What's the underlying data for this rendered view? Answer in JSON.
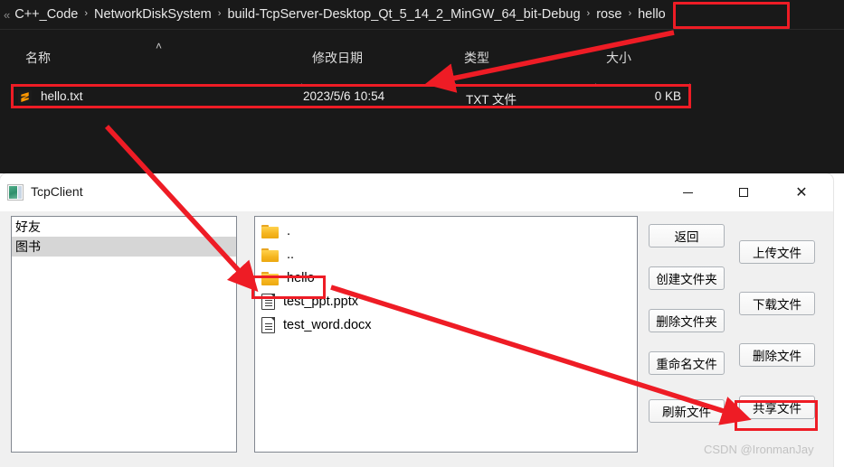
{
  "explorer": {
    "breadcrumb": {
      "overflow_glyph": "«",
      "separator": "›",
      "items": [
        {
          "label": "C++_Code"
        },
        {
          "label": "NetworkDiskSystem"
        },
        {
          "label": "build-TcpServer-Desktop_Qt_5_14_2_MinGW_64_bit-Debug"
        },
        {
          "label": "rose"
        },
        {
          "label": "hello"
        }
      ],
      "highlight_color": "#ee1c25"
    },
    "columns": [
      {
        "label": "名称",
        "sort_caret": "˄"
      },
      {
        "label": "修改日期"
      },
      {
        "label": "类型"
      },
      {
        "label": "大小"
      }
    ],
    "rows": [
      {
        "icon": "sublime-text-icon",
        "name": "hello.txt",
        "date_modified": "2023/5/6 10:54",
        "type": "TXT 文件",
        "size": "0 KB"
      }
    ]
  },
  "window": {
    "title": "TcpClient",
    "icon": "qt-app-icon",
    "controls": {
      "minimize": "—",
      "maximize": "□",
      "close": "✕"
    }
  },
  "friends_panel": {
    "items": [
      {
        "label": "好友",
        "selected": false
      },
      {
        "label": "图书",
        "selected": true
      }
    ]
  },
  "files_panel": {
    "items": [
      {
        "icon": "folder-icon",
        "label": ".",
        "highlighted": false
      },
      {
        "icon": "folder-icon",
        "label": "..",
        "highlighted": false
      },
      {
        "icon": "folder-icon",
        "label": "hello",
        "highlighted": true
      },
      {
        "icon": "document-icon",
        "label": "test_ppt.pptx",
        "highlighted": false
      },
      {
        "icon": "document-icon",
        "label": "test_word.docx",
        "highlighted": false
      }
    ]
  },
  "buttons": {
    "left_column": [
      {
        "label": "返回"
      },
      {
        "label": "创建文件夹"
      },
      {
        "label": "删除文件夹"
      },
      {
        "label": "重命名文件"
      },
      {
        "label": "刷新文件"
      }
    ],
    "right_column": [
      {
        "label": "上传文件",
        "highlighted": false
      },
      {
        "label": "下载文件",
        "highlighted": false
      },
      {
        "label": "删除文件",
        "highlighted": false
      },
      {
        "label": "共享文件",
        "highlighted": true
      }
    ]
  },
  "watermark": {
    "text": "CSDN @IronmanJay"
  },
  "annotations": {
    "color": "#ee1c25",
    "arrow_count": 3
  }
}
